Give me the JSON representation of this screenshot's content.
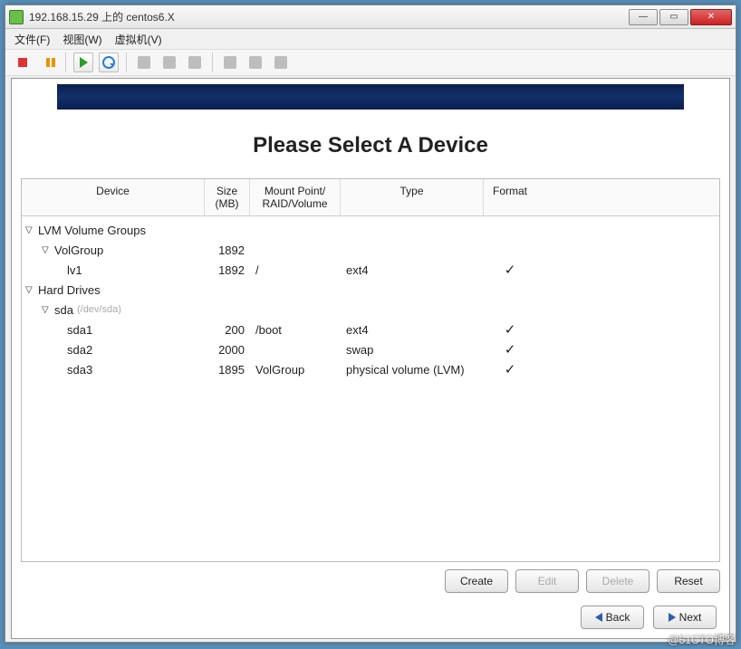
{
  "window": {
    "title": "192.168.15.29 上的 centos6.X"
  },
  "menubar": {
    "file": "文件(F)",
    "view": "视图(W)",
    "vm": "虚拟机(V)"
  },
  "page": {
    "title": "Please Select A Device"
  },
  "columns": {
    "device": "Device",
    "size": "Size\n(MB)",
    "mount": "Mount Point/\nRAID/Volume",
    "type": "Type",
    "format": "Format"
  },
  "tree": {
    "lvm_groups_label": "LVM Volume Groups",
    "volgroup": {
      "name": "VolGroup",
      "size": "1892"
    },
    "lv1": {
      "name": "lv1",
      "size": "1892",
      "mount": "/",
      "type": "ext4",
      "format": "✓"
    },
    "hard_drives_label": "Hard Drives",
    "sda": {
      "name": "sda",
      "hint": "(/dev/sda)"
    },
    "sda1": {
      "name": "sda1",
      "size": "200",
      "mount": "/boot",
      "type": "ext4",
      "format": "✓"
    },
    "sda2": {
      "name": "sda2",
      "size": "2000",
      "mount": "",
      "type": "swap",
      "format": "✓"
    },
    "sda3": {
      "name": "sda3",
      "size": "1895",
      "mount": "VolGroup",
      "type": "physical volume (LVM)",
      "format": "✓"
    }
  },
  "buttons": {
    "create": "Create",
    "edit": "Edit",
    "delete": "Delete",
    "reset": "Reset",
    "back": "Back",
    "next": "Next"
  },
  "watermark": "@51CTO博客"
}
